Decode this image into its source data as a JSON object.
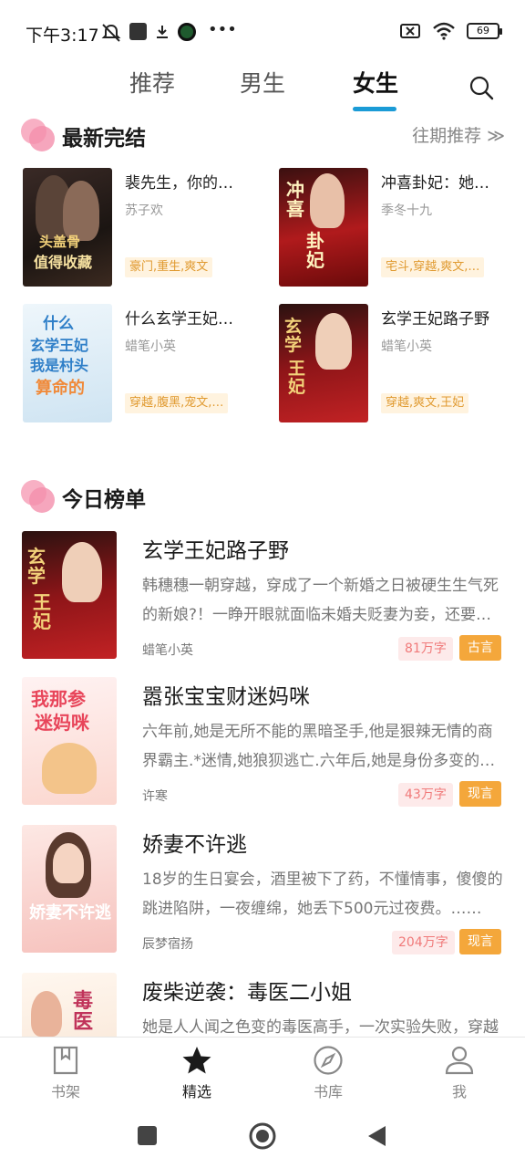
{
  "status_bar": {
    "time": "下午3:17",
    "battery": "69"
  },
  "tabs": [
    {
      "label": "推荐"
    },
    {
      "label": "男生"
    },
    {
      "label": "女生",
      "active": true
    }
  ],
  "completed": {
    "title": "最新完结",
    "more": "往期推荐 ≫",
    "books": [
      {
        "title": "裴先生，你的…",
        "author": "苏子欢",
        "tags": "豪门,重生,爽文",
        "cover_text": "裴先生\n头盖骨\n值得收藏"
      },
      {
        "title": "冲喜卦妃：她…",
        "author": "季冬十九",
        "tags": "宅斗,穿越,爽文,…",
        "cover_text": "冲喜卦妃"
      },
      {
        "title": "什么玄学王妃…",
        "author": "蜡笔小英",
        "tags": "穿越,腹黑,宠文,…",
        "cover_text": "什么\n玄学王妃\n我是村头\n算命的"
      },
      {
        "title": "玄学王妃路子野",
        "author": "蜡笔小英",
        "tags": "穿越,爽文,王妃",
        "cover_text": "玄学王妃"
      }
    ]
  },
  "ranking": {
    "title": "今日榜单",
    "books": [
      {
        "title": "玄学王妃路子野",
        "desc": "韩穗穗一朝穿越，穿成了一个新婚之日被硬生生气死的新娘?！一睁开眼就面临未婚夫贬妻为妾，还要被逼着给小妾敬茶……",
        "author": "蜡笔小英",
        "words": "81万字",
        "category": "古言"
      },
      {
        "title": "嚣张宝宝财迷妈咪",
        "desc": "六年前,她是无所不能的黑暗圣手,他是狠辣无情的商界霸主.*迷情,她狼狈逃亡.六年后,她是身份多变的神秘高手……",
        "author": "许寒",
        "words": "43万字",
        "category": "现言"
      },
      {
        "title": "娇妻不许逃",
        "desc": "18岁的生日宴会，酒里被下了药，不懂情事，傻傻的跳进陷阱，一夜缠绵，她丢下500元过夜费。……",
        "author": "辰梦宿扬",
        "words": "204万字",
        "category": "现言"
      },
      {
        "title": "废柴逆袭：毒医二小姐",
        "desc": "她是人人闻之色变的毒医高手，一次实验失败，穿越成了废柴二小姐……",
        "author": "",
        "words": "",
        "category": ""
      }
    ]
  },
  "bottom_nav": [
    {
      "label": "书架",
      "icon": "bookshelf-icon"
    },
    {
      "label": "精选",
      "icon": "star-icon",
      "active": true
    },
    {
      "label": "书库",
      "icon": "compass-icon"
    },
    {
      "label": "我",
      "icon": "profile-icon"
    }
  ],
  "colors": {
    "accent": "#1b9bd6",
    "tag_bg": "#fff3df",
    "tag_text": "#e09a30",
    "category_bg": "#f4a73b",
    "words_bg": "#fdeaea",
    "words_text": "#f07a7a"
  }
}
